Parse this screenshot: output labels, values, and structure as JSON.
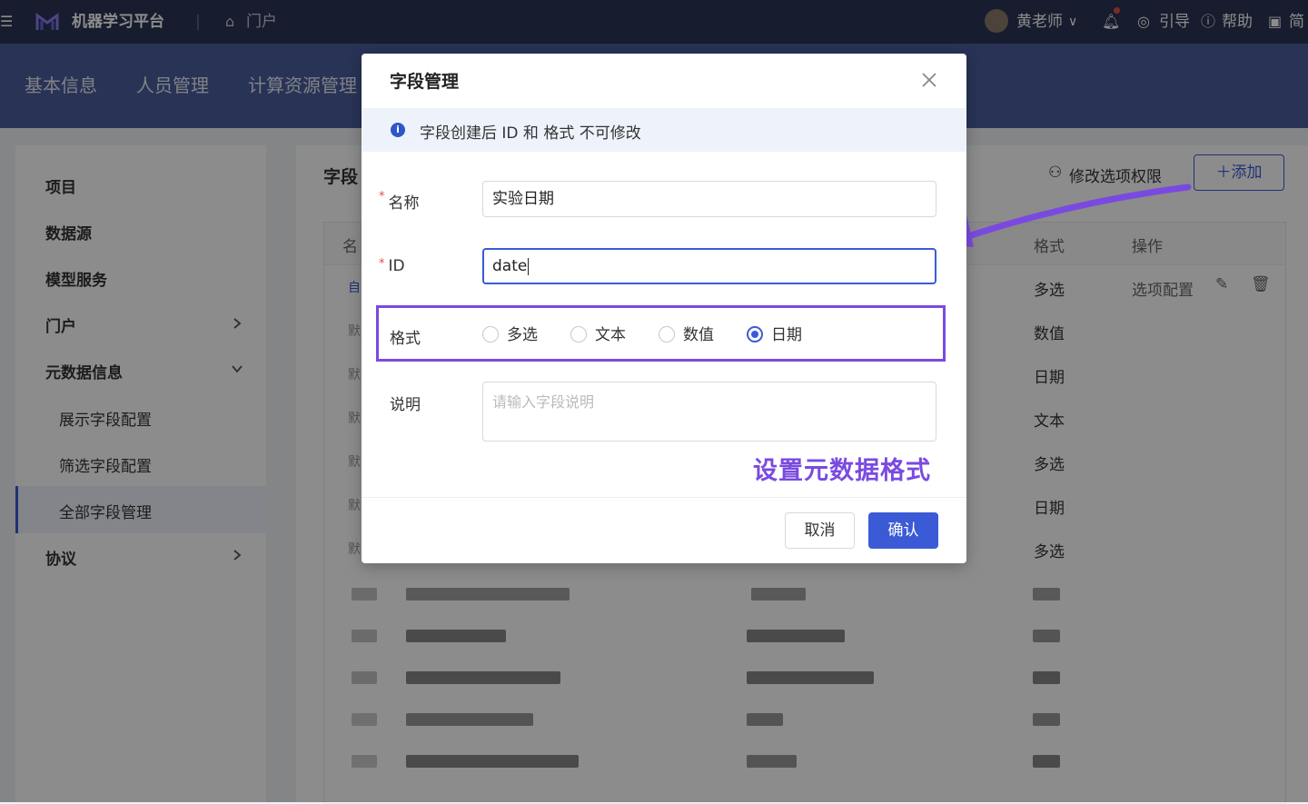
{
  "topbar": {
    "app_title": "机器学习平台",
    "portal": "门户",
    "user": "黄老师",
    "guide": "引导",
    "help": "帮助",
    "lang": "简"
  },
  "subnav": [
    "基本信息",
    "人员管理",
    "计算资源管理"
  ],
  "sidebar": {
    "items": [
      "项目",
      "数据源",
      "模型服务",
      "门户",
      "元数据信息"
    ],
    "sub_items": [
      "展示字段配置",
      "筛选字段配置",
      "全部字段管理"
    ],
    "last_item": "协议"
  },
  "main": {
    "page_title": "字段",
    "modify_perm": "修改选项权限",
    "add": "添加",
    "table_headers": {
      "name": "名",
      "format": "格式",
      "action": "操作"
    },
    "row_marks": [
      "自",
      "默",
      "默",
      "默",
      "默",
      "默",
      "默"
    ],
    "formats": [
      "多选",
      "数值",
      "日期",
      "文本",
      "多选",
      "日期",
      "多选"
    ],
    "option_config": "选项配置"
  },
  "modal": {
    "title": "字段管理",
    "notice": "字段创建后 ID 和 格式 不可修改",
    "name_label": "名称",
    "name_value": "实验日期",
    "id_label": "ID",
    "id_value": "date",
    "format_label": "格式",
    "format_options": [
      "多选",
      "文本",
      "数值",
      "日期"
    ],
    "format_selected": "日期",
    "desc_label": "说明",
    "desc_placeholder": "请输入字段说明",
    "cancel": "取消",
    "confirm": "确认"
  },
  "annotation": "设置元数据格式",
  "colors": {
    "accent": "#3b5bd6",
    "highlight": "#7a4ae0",
    "topbar": "#2b3354"
  }
}
